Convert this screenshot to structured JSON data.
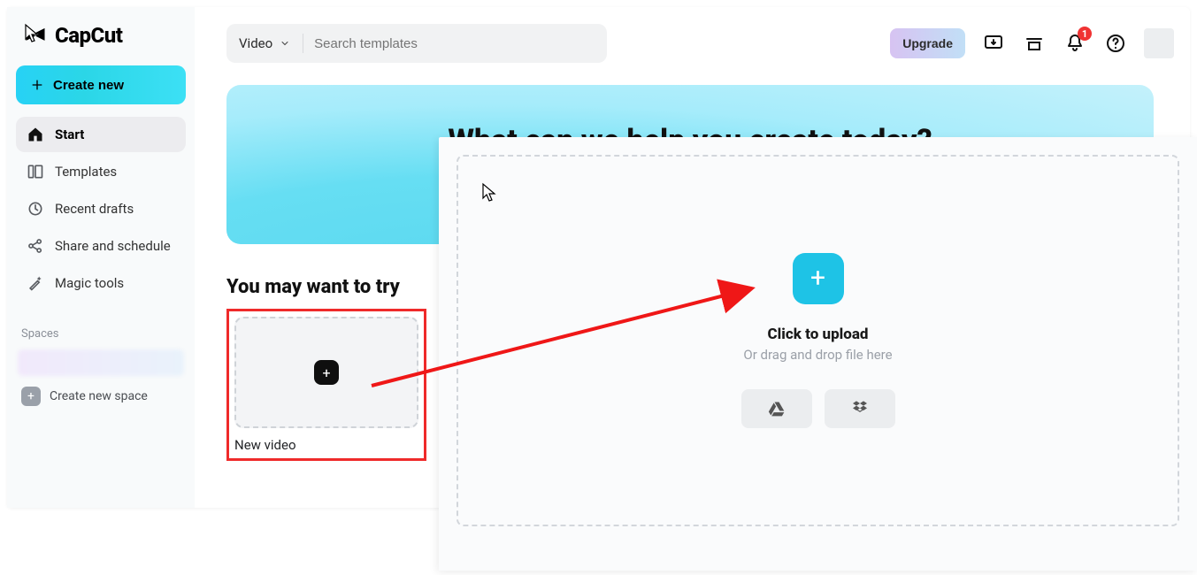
{
  "brand": "CapCut",
  "sidebar": {
    "create_label": "Create new",
    "items": [
      {
        "label": "Start"
      },
      {
        "label": "Templates"
      },
      {
        "label": "Recent drafts"
      },
      {
        "label": "Share and schedule"
      },
      {
        "label": "Magic tools"
      }
    ],
    "spaces_label": "Spaces",
    "create_space_label": "Create new space"
  },
  "topbar": {
    "category": "Video",
    "search_placeholder": "Search templates",
    "upgrade_label": "Upgrade",
    "notif_count": "1"
  },
  "hero": {
    "headline": "What can we help you create today?"
  },
  "try_section": {
    "heading": "You may want to try",
    "card_label": "New video"
  },
  "upload": {
    "title": "Click to upload",
    "subtitle": "Or drag and drop file here"
  }
}
